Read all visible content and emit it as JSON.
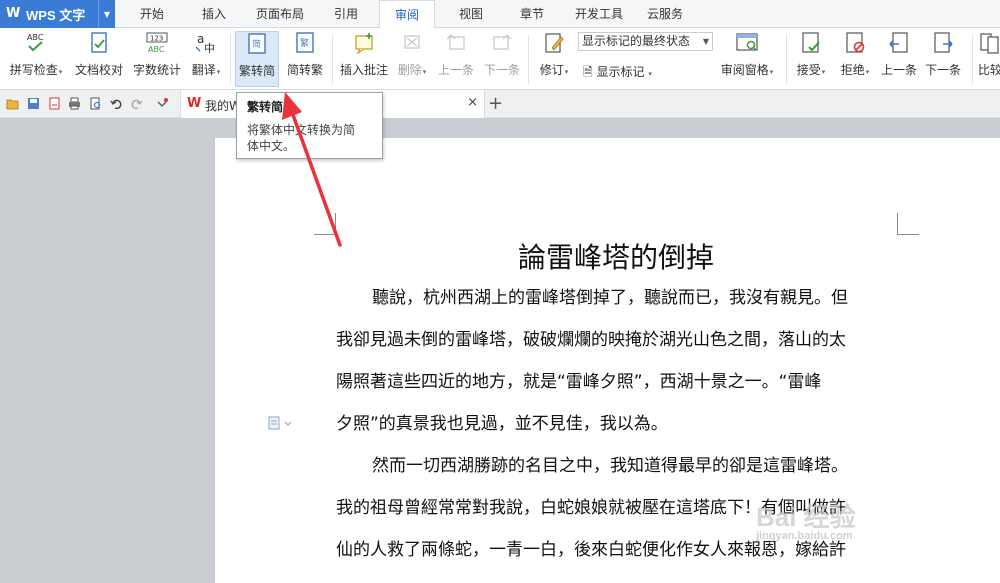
{
  "app": {
    "title": "WPS 文字",
    "logo": "W",
    "accent": "#3a7bd5"
  },
  "menu_tabs": [
    "开始",
    "插入",
    "页面布局",
    "引用",
    "审阅",
    "视图",
    "章节",
    "开发工具",
    "云服务"
  ],
  "active_tab": "审阅",
  "ribbon": {
    "spell_check": "拼写检查",
    "doc_proof": "文档校对",
    "word_count": "字数统计",
    "translate": "翻译",
    "trad_to_simp": "繁转简",
    "simp_to_trad": "简转繁",
    "insert_comment": "插入批注",
    "delete": "删除",
    "prev": "上一条",
    "next": "下一条",
    "revise": "修订",
    "markup_dropdown": "显示标记的最终状态",
    "show_markup": "显示标记",
    "review_pane": "审阅窗格",
    "accept": "接受",
    "reject": "拒绝",
    "prev_change": "上一条",
    "next_change": "下一条",
    "compare": "比较"
  },
  "doc_tab": {
    "label": "我的W",
    "close": "×",
    "new_tab": "+"
  },
  "tooltip": {
    "title": "繁转简",
    "description_line1": "将繁体中文转换为简",
    "description_line2": "体中文。"
  },
  "document": {
    "title": "論雷峰塔的倒掉",
    "lines": [
      "聽說，杭州西湖上的雷峰塔倒掉了，聽說而已，我沒有親見。但",
      "我卻見過未倒的雷峰塔，破破爛爛的映掩於湖光山色之間，落山的太",
      "陽照著這些四近的地方，就是“雷峰夕照”，西湖十景之一。“雷峰",
      "夕照”的真景我也見過，並不見佳，我以為。",
      "然而一切西湖勝跡的名目之中，我知道得最早的卻是這雷峰塔。",
      "我的祖母曾經常常對我說，白蛇娘娘就被壓在這塔底下！有個叫做許",
      "仙的人救了兩條蛇，一青一白，後來白蛇便化作女人來報恩，嫁給許"
    ]
  },
  "watermark": {
    "text": "Bai 经验",
    "sub": "jingyan.baidu.com"
  },
  "annotation_color": "#e8323c"
}
